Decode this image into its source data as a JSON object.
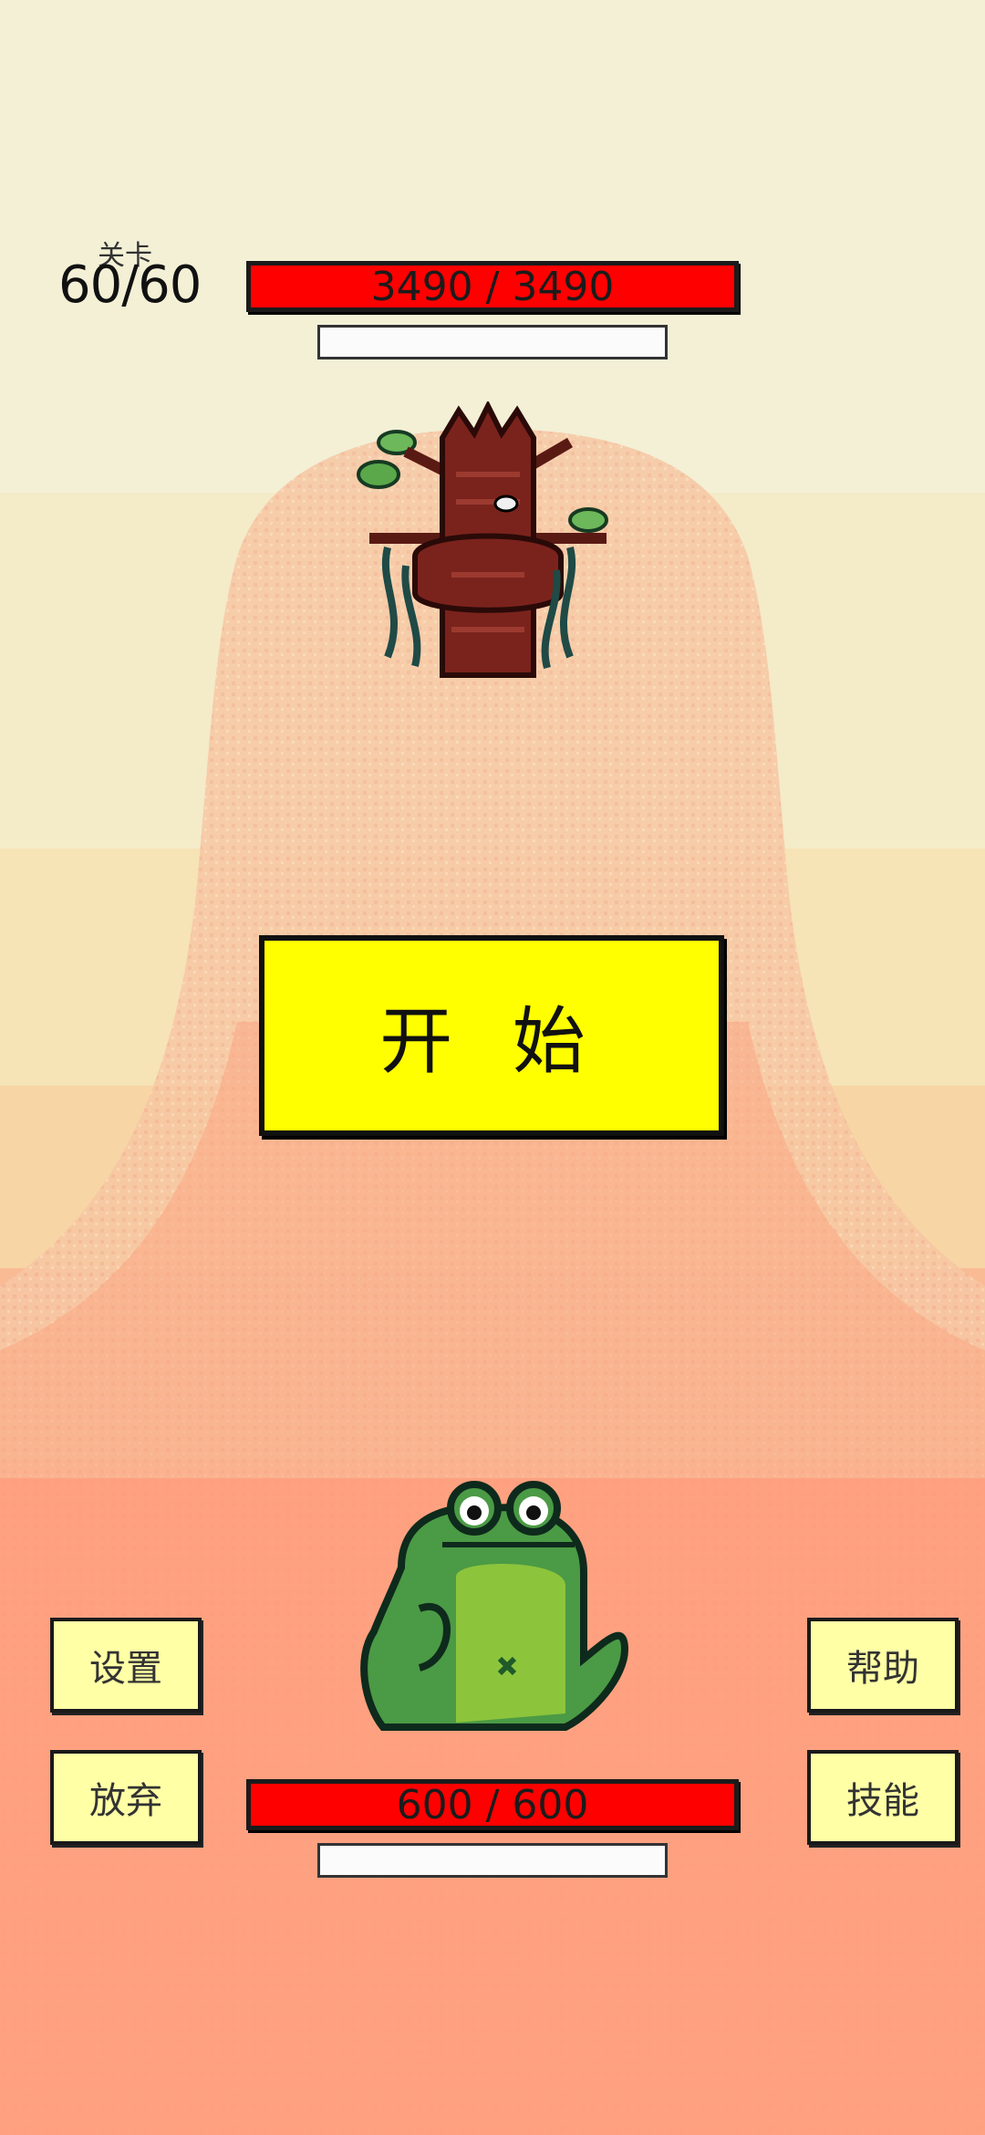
{
  "level": {
    "label": "关卡",
    "value": "60/60"
  },
  "enemy": {
    "name_icon": "tree-monster-icon",
    "hp_text": "3490 / 3490",
    "hp_fraction": 1.0
  },
  "player": {
    "name_icon": "frog-icon",
    "hp_text": "600 / 600",
    "hp_fraction": 1.0
  },
  "start_button": {
    "label": "开 始"
  },
  "buttons": {
    "settings": "设置",
    "give_up": "放弃",
    "help": "帮助",
    "skills": "技能"
  },
  "colors": {
    "hp_red": "#ff0000",
    "start_yellow": "#ffff00",
    "button_cream": "#ffffa6"
  }
}
